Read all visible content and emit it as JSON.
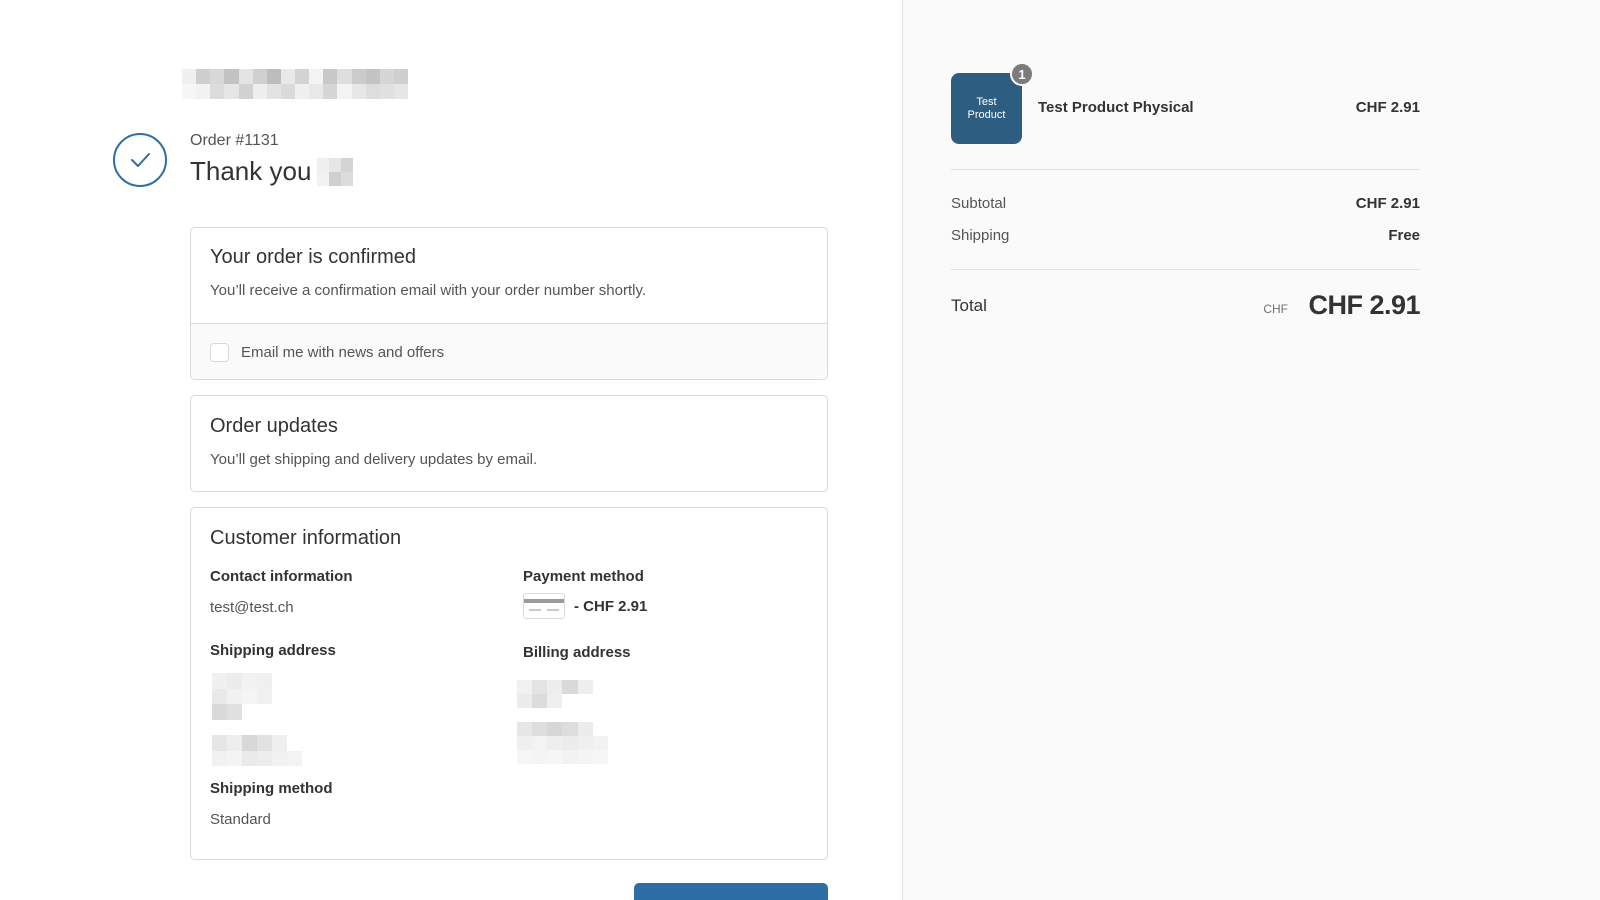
{
  "order": {
    "number_label": "Order #1131",
    "thank_you": "Thank you"
  },
  "confirmed_card": {
    "title": "Your order is confirmed",
    "text": "You’ll receive a confirmation email with your order number shortly.",
    "newsletter_label": "Email me with news and offers"
  },
  "updates_card": {
    "title": "Order updates",
    "text": "You’ll get shipping and delivery updates by email."
  },
  "customer_card": {
    "title": "Customer information",
    "contact_label": "Contact information",
    "contact_email": "test@test.ch",
    "payment_label": "Payment method",
    "payment_amount": "- CHF 2.91",
    "shipping_address_label": "Shipping address",
    "billing_address_label": "Billing address",
    "shipping_method_label": "Shipping method",
    "shipping_method_value": "Standard"
  },
  "summary": {
    "product": {
      "thumb_text": "Test Product",
      "quantity": "1",
      "name": "Test Product Physical",
      "price": "CHF 2.91"
    },
    "subtotal_label": "Subtotal",
    "subtotal_value": "CHF 2.91",
    "shipping_label": "Shipping",
    "shipping_value": "Free",
    "total_label": "Total",
    "total_currency": "CHF",
    "total_value": "CHF 2.91"
  },
  "colors": {
    "accent": "#2c6ea5",
    "product_thumb": "#2d5e82",
    "sidebar_bg": "#fafafa",
    "border": "#d9d9d9"
  },
  "icons": {
    "check": "checkmark-circle-icon",
    "payment": "credit-card-icon"
  }
}
